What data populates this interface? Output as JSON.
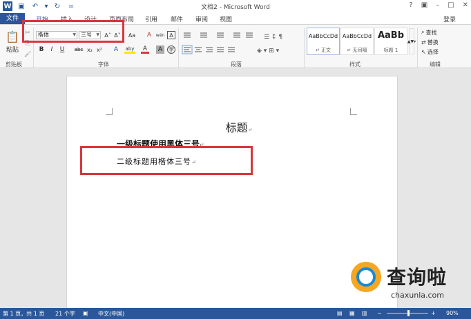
{
  "window": {
    "title": "文档2 - Microsoft Word",
    "controls": [
      "?",
      "▣",
      "–",
      "□",
      "✕"
    ]
  },
  "qat": {
    "word_icon": "W",
    "save_icon": "▣",
    "undo_icon": "↶",
    "undo_arrow": "▾",
    "redo_icon": "↻",
    "more_icon": "="
  },
  "tabs": {
    "file": "文件",
    "items": [
      "开始",
      "插入",
      "设计",
      "页面布局",
      "引用",
      "邮件",
      "审阅",
      "视图"
    ],
    "login": "登录"
  },
  "ribbon": {
    "clipboard": {
      "paste": "粘贴",
      "paste_icon": "📋",
      "cut_icon": "✂",
      "copy_icon": "⎘",
      "painter_icon": "🖌",
      "label": "剪贴板"
    },
    "font": {
      "font_name": "楷体",
      "font_size": "三号",
      "grow": "A˄",
      "shrink": "A˅",
      "case": "Aa",
      "clear": "A",
      "phonetic": "wén",
      "border": "A",
      "bold": "B",
      "italic": "I",
      "underline": "U",
      "strike": "abc",
      "sub": "x₂",
      "sup": "x²",
      "effects": "A",
      "highlight": "aby",
      "color": "A",
      "shading": "A",
      "enclose": "字",
      "label": "字体"
    },
    "paragraph": {
      "label": "段落"
    },
    "styles": {
      "items": [
        {
          "sample": "AaBbCcDd",
          "name": "↵ 正文"
        },
        {
          "sample": "AaBbCcDd",
          "name": "↵ 无间隔"
        },
        {
          "sample": "AaBb",
          "name": "标题 1"
        }
      ],
      "label": "样式"
    },
    "editing": {
      "find": "查找",
      "replace": "替换",
      "select": "选择",
      "label": "编辑"
    }
  },
  "document": {
    "title": "标题",
    "heading1": "一级标题使用黑体三号",
    "heading2": "二级标题用楷体三号",
    "pilcrow": "↵"
  },
  "statusbar": {
    "page": "第 1 页，共 1 页",
    "words": "21 个字",
    "lang": "中文(中国)",
    "zoom": "90%"
  },
  "watermark": {
    "text": "查询啦",
    "sub": "chaxunla.com"
  },
  "colors": {
    "accent": "#2b579a",
    "highlight_box": "#d9363e"
  }
}
